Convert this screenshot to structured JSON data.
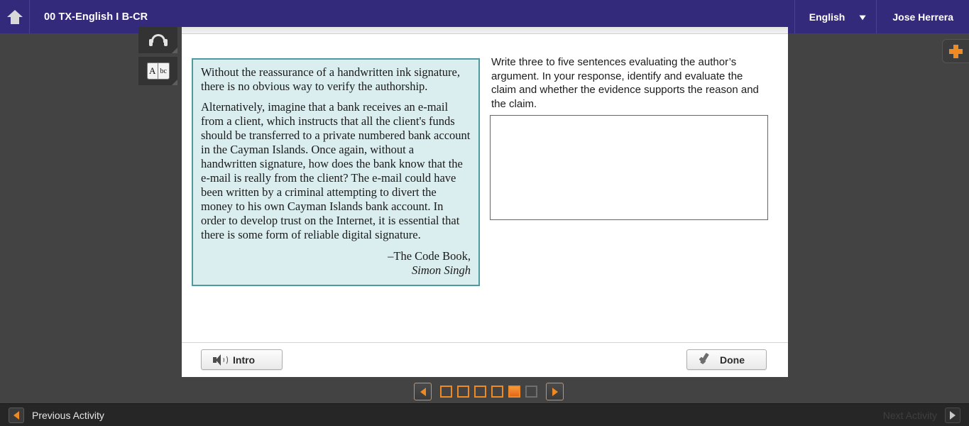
{
  "header": {
    "home_icon": "home-icon",
    "course_title": "00 TX-English I B-CR",
    "language_label": "English",
    "chevron": "⌄",
    "user_name": "Jose Herrera"
  },
  "tool_rail": {
    "buttons": [
      {
        "name": "headphones-icon",
        "label": "Listen"
      },
      {
        "name": "dictionary-icon",
        "page_left": "A",
        "page_right": "bc"
      }
    ]
  },
  "passage": {
    "paragraph_1": "Without the reassurance of a handwritten ink signature, there is no obvious way to verify the authorship.",
    "paragraph_2": "Alternatively, imagine that a bank receives an e-mail from a client, which instructs that all the client's funds should be transferred to a private numbered bank account in the Cayman Islands. Once again, without a handwritten signature, how does the bank know that the e-mail is really from the client? The e-mail could have been written by a criminal attempting to divert the money to his own Cayman Islands bank account. In order to develop trust on the Internet, it is essential that there is some form of reliable digital signature.",
    "source": "–The Code Book,",
    "author": "Simon Singh",
    "border_color": "#4e9a9c",
    "background_color": "#daedef"
  },
  "question": {
    "prompt": "Write three to five sentences evaluating the author’s argument. In your response, identify and evaluate the claim and whether the evidence supports the reason and the claim.",
    "answer_value": "",
    "answer_placeholder": ""
  },
  "footer": {
    "intro_label": "Intro",
    "intro_icon": "speaker-icon",
    "done_label": "Done",
    "done_icon": "checkmark-icon"
  },
  "pager": {
    "prev_icon": "triangle-left-icon",
    "next_icon": "triangle-right-icon",
    "accent_color": "#ef8a22",
    "pages": [
      {
        "index": 1,
        "state": "normal"
      },
      {
        "index": 2,
        "state": "normal"
      },
      {
        "index": 3,
        "state": "normal"
      },
      {
        "index": 4,
        "state": "normal"
      },
      {
        "index": 5,
        "state": "active"
      },
      {
        "index": 6,
        "state": "disabled"
      }
    ]
  },
  "bottom_bar": {
    "previous_label": "Previous Activity",
    "next_label": "Next Activity",
    "previous_icon": "triangle-left-icon",
    "next_icon": "triangle-right-icon",
    "next_enabled": false
  },
  "side_tab": {
    "plus_icon": "plus-icon",
    "color": "#ef8a22"
  }
}
